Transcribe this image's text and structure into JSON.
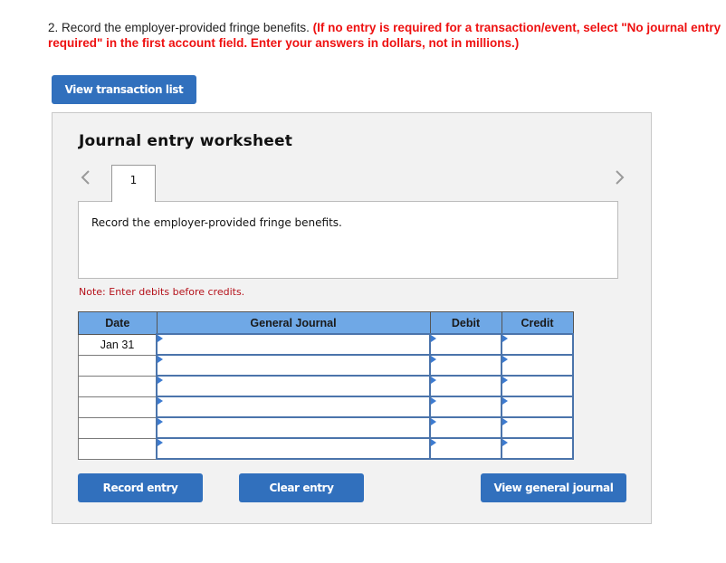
{
  "question": {
    "number_text": "2. Record the employer-provided fringe benefits.",
    "instructions": "(If no entry is required for a transaction/event, select \"No journal entry required\" in the first account field. Enter your answers in dollars, not in millions.)"
  },
  "buttons": {
    "view_transaction_list": "View transaction list",
    "record_entry": "Record entry",
    "clear_entry": "Clear entry",
    "view_general_journal": "View general journal"
  },
  "worksheet": {
    "title": "Journal entry worksheet",
    "tabs": [
      {
        "label": "1"
      }
    ],
    "description": "Record the employer-provided fringe benefits.",
    "note": "Note: Enter debits before credits.",
    "icons": {
      "prev": "chevron-left-icon",
      "next": "chevron-right-icon"
    }
  },
  "table": {
    "headers": {
      "date": "Date",
      "general_journal": "General Journal",
      "debit": "Debit",
      "credit": "Credit"
    },
    "rows": [
      {
        "date": "Jan 31",
        "account": "",
        "debit": "",
        "credit": ""
      },
      {
        "date": "",
        "account": "",
        "debit": "",
        "credit": ""
      },
      {
        "date": "",
        "account": "",
        "debit": "",
        "credit": ""
      },
      {
        "date": "",
        "account": "",
        "debit": "",
        "credit": ""
      },
      {
        "date": "",
        "account": "",
        "debit": "",
        "credit": ""
      },
      {
        "date": "",
        "account": "",
        "debit": "",
        "credit": ""
      }
    ]
  },
  "colors": {
    "button_blue": "#3170bd",
    "header_blue": "#6fa8e6",
    "instruction_red": "#ee1111",
    "note_red": "#b5121b"
  }
}
